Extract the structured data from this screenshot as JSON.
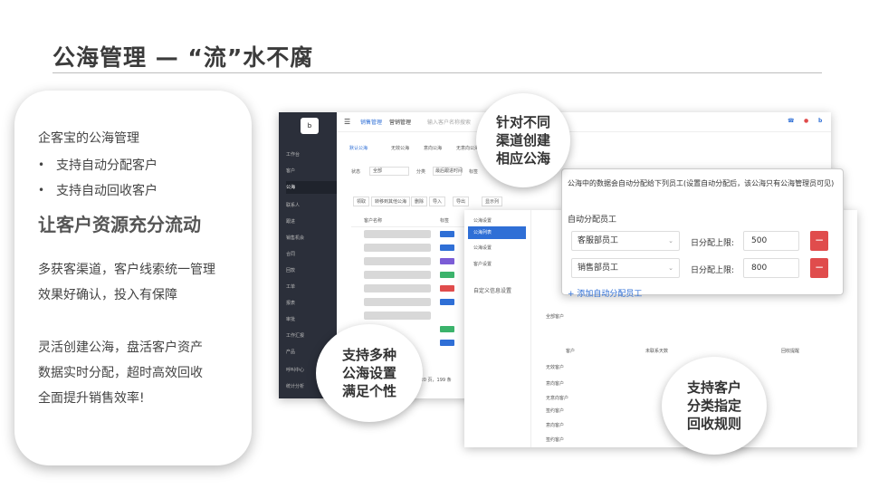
{
  "title": "公海管理 — “流”水不腐",
  "left": {
    "intro": "企客宝的公海管理",
    "bullets": [
      "支持自动分配客户",
      "支持自动回收客户"
    ],
    "headline": "让客户资源充分流动",
    "para1": [
      "多获客渠道，客户线索统一管理",
      "效果好确认，投入有保障"
    ],
    "para2": [
      "灵活创建公海，盘活客户资产",
      "数据实时分配，超时高效回收",
      "全面提升销售效率!"
    ]
  },
  "bubbles": {
    "b1": [
      "针对不同",
      "渠道创建",
      "相应公海"
    ],
    "b2": [
      "支持多种",
      "公海设置",
      "满足个性"
    ],
    "b3": [
      "支持客户",
      "分类指定",
      "回收规则"
    ]
  },
  "shot1": {
    "top_tabs": [
      "销售管理",
      "营销管理"
    ],
    "search_placeholder": "输入客户名称搜索",
    "nav": [
      "工作台",
      "客户",
      "公海",
      "联系人",
      "跟进",
      "销售机会",
      "合同",
      "回款",
      "工单",
      "报表",
      "审批",
      "工作汇报",
      "产品",
      "呼叫中心",
      "统计分析"
    ],
    "nav_active": "公海",
    "sub_tabs": [
      "默认公海",
      "无效公海",
      "意向公海",
      "无意向公海"
    ],
    "filter_labels": [
      "状态",
      "全部",
      "分类",
      "最后跟进时间",
      "标签"
    ],
    "actions": [
      "领取",
      "转移到其他公海",
      "删除",
      "导入",
      "导出",
      "显示列"
    ],
    "col_head": [
      "客户名称",
      "标签"
    ],
    "pager": "共 20 页，199 条"
  },
  "shot2": {
    "menu": [
      "公海设置",
      "公海列表",
      "公海设置",
      "客户设置"
    ],
    "custom_title": "自定义信息设置",
    "rows": [
      "全部客户",
      "无效客户",
      "意向客户",
      "无意向客户",
      "签约客户",
      "意向客户",
      "签约客户"
    ],
    "cols": [
      "客户",
      "未联系天数",
      "回收提醒"
    ]
  },
  "panel": {
    "title": "公海中的数据会自动分配给下列员工(设置自动分配后，该公海只有公海管理员可见)",
    "label": "自动分配员工",
    "rows": [
      {
        "employee": "客服部员工",
        "limit_label": "日分配上限:",
        "limit": "500"
      },
      {
        "employee": "销售部员工",
        "limit_label": "日分配上限:",
        "limit": "800"
      }
    ],
    "add_link": "+ 添加自动分配员工"
  },
  "colors": {
    "accent": "#2f6fd6",
    "danger": "#e04c4c",
    "nav_bg": "#2b2f3a"
  }
}
